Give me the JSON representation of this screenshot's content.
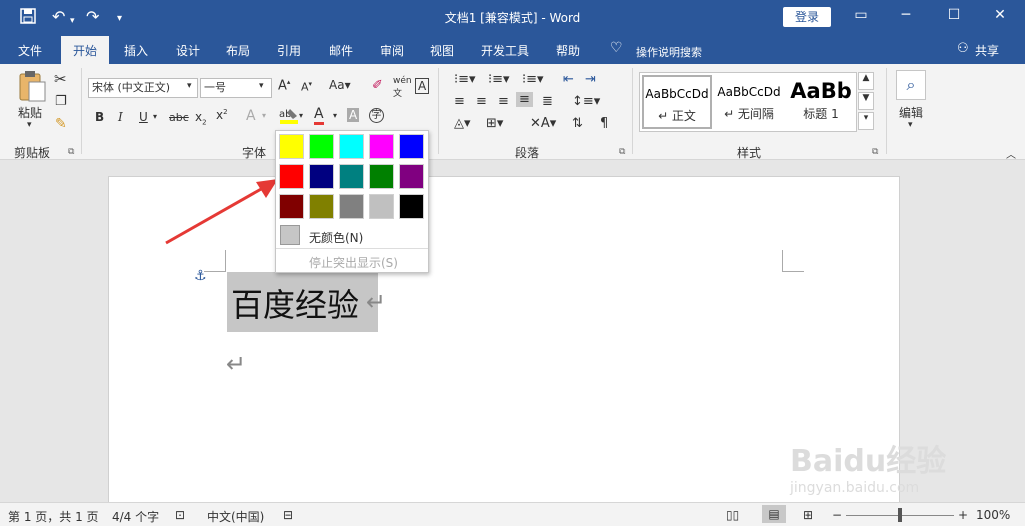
{
  "window": {
    "title": "文档1 [兼容模式] - Word",
    "login_label": "登录"
  },
  "tabs": [
    {
      "label": "文件"
    },
    {
      "label": "开始"
    },
    {
      "label": "插入"
    },
    {
      "label": "设计"
    },
    {
      "label": "布局"
    },
    {
      "label": "引用"
    },
    {
      "label": "邮件"
    },
    {
      "label": "审阅"
    },
    {
      "label": "视图"
    },
    {
      "label": "开发工具"
    },
    {
      "label": "帮助"
    }
  ],
  "tell_me": "操作说明搜索",
  "share": "共享",
  "ribbon": {
    "clipboard": {
      "paste": "粘贴",
      "label": "剪贴板"
    },
    "font": {
      "font_name": "宋体 (中文正文)",
      "font_size": "一号",
      "label": "字体"
    },
    "paragraph": {
      "label": "段落"
    },
    "styles": {
      "label": "样式",
      "items": [
        {
          "sample": "AaBbCcDd",
          "name": "↵ 正文"
        },
        {
          "sample": "AaBbCcDd",
          "name": "↵ 无间隔"
        },
        {
          "sample": "AaBb",
          "name": "标题 1"
        }
      ]
    },
    "editing": {
      "label": "编辑"
    }
  },
  "highlight_menu": {
    "colors": [
      "#ffff00",
      "#00ff00",
      "#00ffff",
      "#ff00ff",
      "#0000ff",
      "#ff0000",
      "#000080",
      "#008080",
      "#008000",
      "#800080",
      "#800000",
      "#808000",
      "#808080",
      "#c0c0c0",
      "#000000"
    ],
    "no_color": "无颜色(N)",
    "stop_highlight": "停止突出显示(S)"
  },
  "document": {
    "text": "百度经验"
  },
  "status": {
    "page": "第 1 页，共 1 页",
    "words": "4/4 个字",
    "language": "中文(中国)",
    "zoom": "100%"
  },
  "watermark": {
    "brand": "Baidu经验",
    "url": "jingyan.baidu.com"
  }
}
